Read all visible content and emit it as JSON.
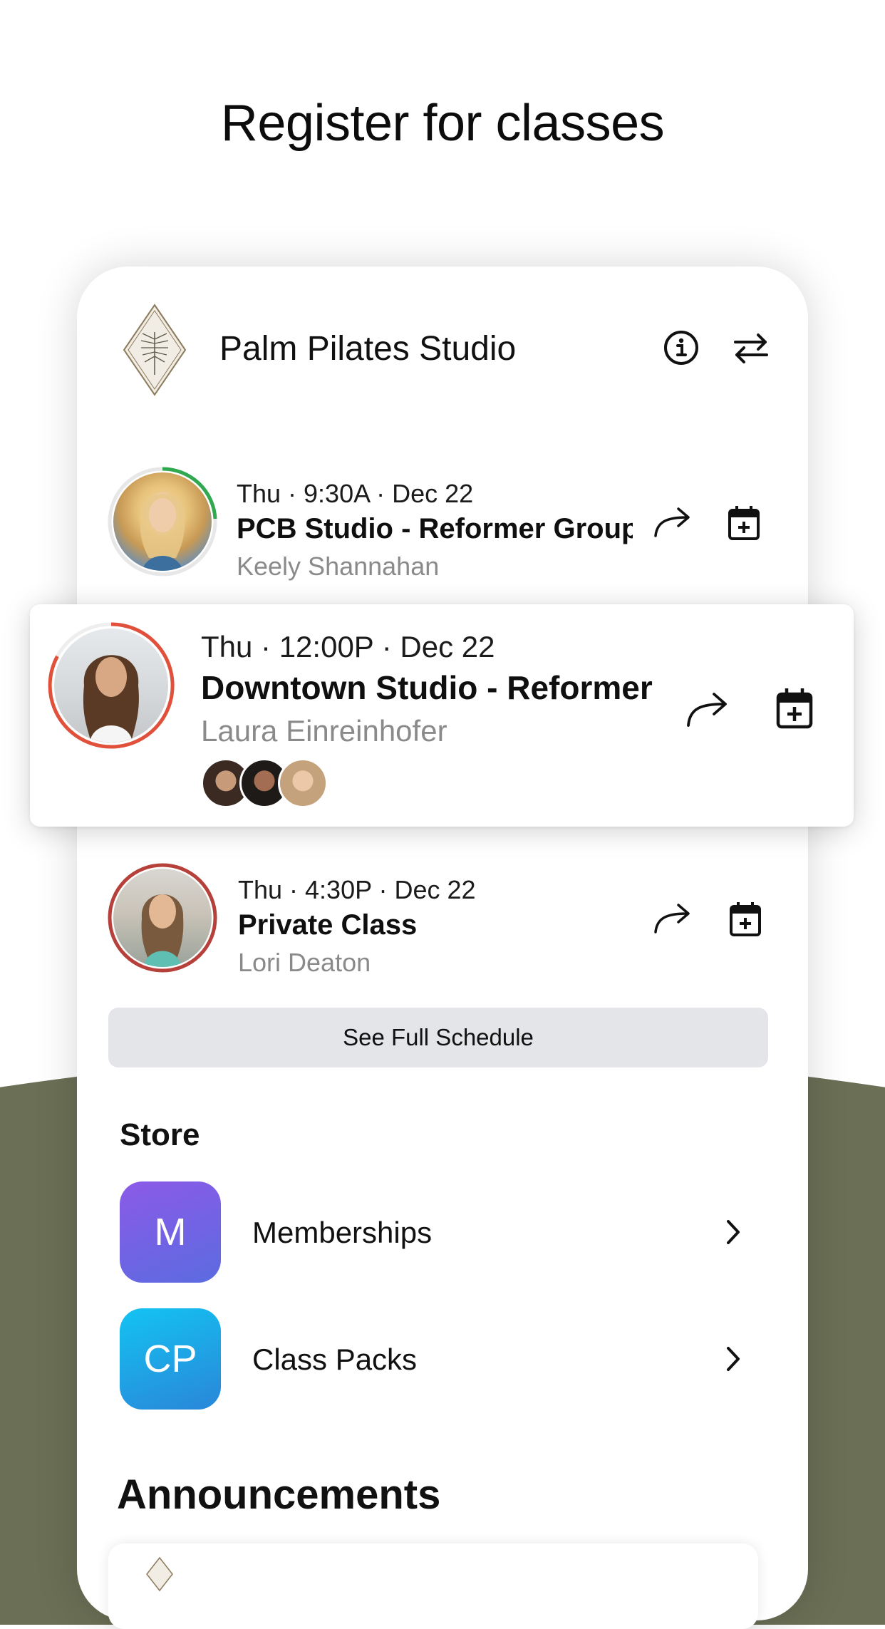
{
  "headline": "Register for classes",
  "studio": {
    "name": "Palm Pilates Studio",
    "info_icon": "info-icon",
    "switch_icon": "swap-arrows-icon"
  },
  "classes": [
    {
      "meta": "Thu · 9:30A · Dec 22",
      "title": "PCB Studio - Reformer Group",
      "instructor": "Keely Shannahan",
      "ring_color": "#2fa84f",
      "ring_fill": 0.22
    },
    {
      "meta": "Thu · 12:00P · Dec 22",
      "title": "Downtown Studio - Reformer",
      "instructor": "Laura Einreinhofer",
      "ring_color": "#e0503a",
      "ring_fill": 0.8,
      "attendee_count": 3
    },
    {
      "meta": "Thu · 4:30P · Dec 22",
      "title": "Private Class",
      "instructor": "Lori Deaton",
      "ring_color": "#b5413a",
      "ring_fill": 1.0
    }
  ],
  "see_full_schedule": "See Full Schedule",
  "store": {
    "title": "Store",
    "items": [
      {
        "badge": "M",
        "label": "Memberships"
      },
      {
        "badge": "CP",
        "label": "Class Packs"
      }
    ]
  },
  "announcements": {
    "title": "Announcements"
  },
  "colors": {
    "olive": "#6a6f55",
    "button_bg": "#e3e5e8",
    "muted_text": "#8a8a8a"
  }
}
